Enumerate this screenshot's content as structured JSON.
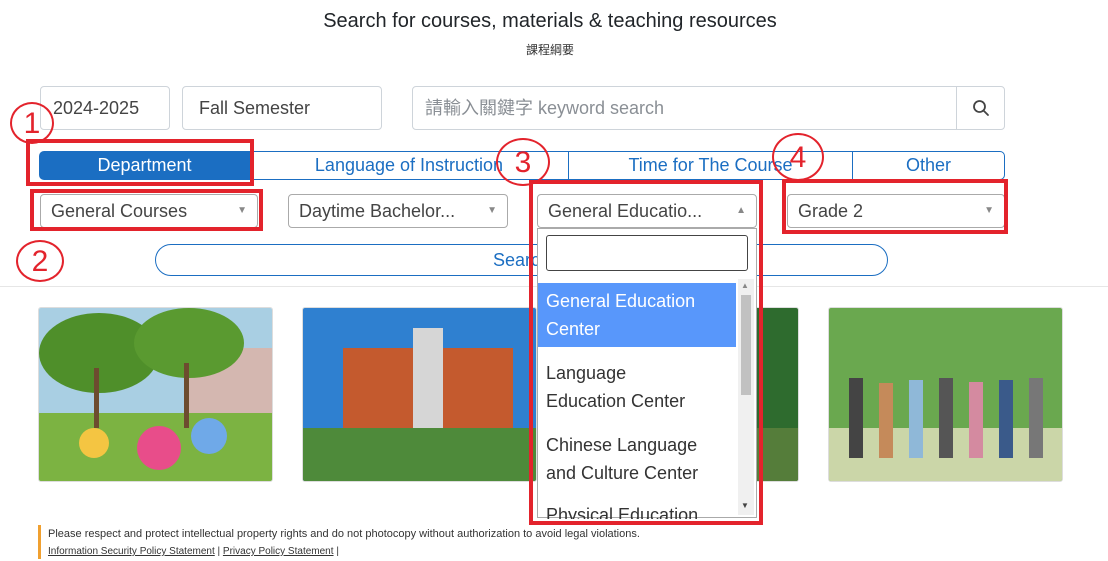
{
  "header": {
    "title": "Search for courses, materials & teaching resources",
    "subtitle": "課程綱要"
  },
  "filters": {
    "year": "2024-2025",
    "semester": "Fall Semester",
    "search_placeholder": "請輸入關鍵字 keyword search"
  },
  "tabs": [
    {
      "label": "Department",
      "active": true
    },
    {
      "label": "Language of Instruction",
      "active": false
    },
    {
      "label": "Time for The Course",
      "active": false
    },
    {
      "label": "Other",
      "active": false
    }
  ],
  "selects": {
    "category": "General Courses",
    "system": "Daytime Bachelor...",
    "department": "General Educatio...",
    "grade": "Grade 2"
  },
  "dropdown": {
    "options": [
      [
        "General Education",
        "Center"
      ],
      [
        "Language",
        "Education Center"
      ],
      [
        "Chinese Language",
        "and Culture Center"
      ],
      [
        "Physical Education",
        ""
      ]
    ],
    "highlighted_index": 0
  },
  "search_button_label": "Search",
  "annotations": [
    "1",
    "2",
    "3",
    "4"
  ],
  "footer": {
    "notice": "Please respect and protect intellectual property rights and do not photocopy without authorization to avoid legal violations.",
    "link_security": "Information Security Policy Statement",
    "link_privacy": "Privacy Policy Statement",
    "separator": "|"
  },
  "colors": {
    "primary": "#1b6ec2",
    "annotation_red": "#e3232c",
    "highlight": "#5897fb"
  },
  "icons": {
    "search": "magnifier-icon",
    "caret_down": "▼",
    "caret_up": "▲"
  }
}
